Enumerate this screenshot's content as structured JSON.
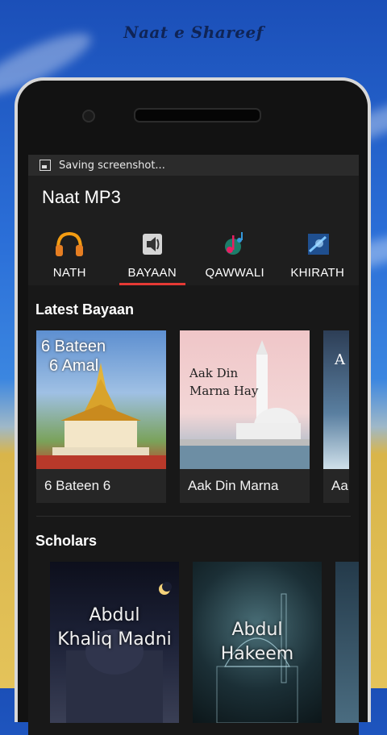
{
  "banner": {
    "title": "Naat e Shareef"
  },
  "statusbar": {
    "notification": "Saving screenshot..."
  },
  "appbar": {
    "title": "Naat MP3"
  },
  "tabs": [
    {
      "label": "NATH",
      "icon": "headphones-icon",
      "active": false
    },
    {
      "label": "BAYAAN",
      "icon": "speaker-icon",
      "active": true
    },
    {
      "label": "QAWWALI",
      "icon": "music-notes-icon",
      "active": false
    },
    {
      "label": "KHIRATH",
      "icon": "book-icon",
      "active": false
    }
  ],
  "latest": {
    "title": "Latest Bayaan",
    "cards": [
      {
        "caption": "6 Bateen 6",
        "overlay_line1": "6 Bateen",
        "overlay_line2": "6 Amal"
      },
      {
        "caption": "Aak Din Marna",
        "overlay_line1": "Aak Din",
        "overlay_line2": "Marna Hay"
      },
      {
        "caption": "Aa",
        "overlay_line1": "A"
      }
    ]
  },
  "scholars": {
    "title": "Scholars",
    "items": [
      {
        "line1": "Abdul",
        "line2": "Khaliq Madni"
      },
      {
        "line1": "Abdul",
        "line2": "Hakeem"
      }
    ]
  },
  "colors": {
    "accent": "#e53935",
    "background": "#181818",
    "card": "#262626"
  }
}
